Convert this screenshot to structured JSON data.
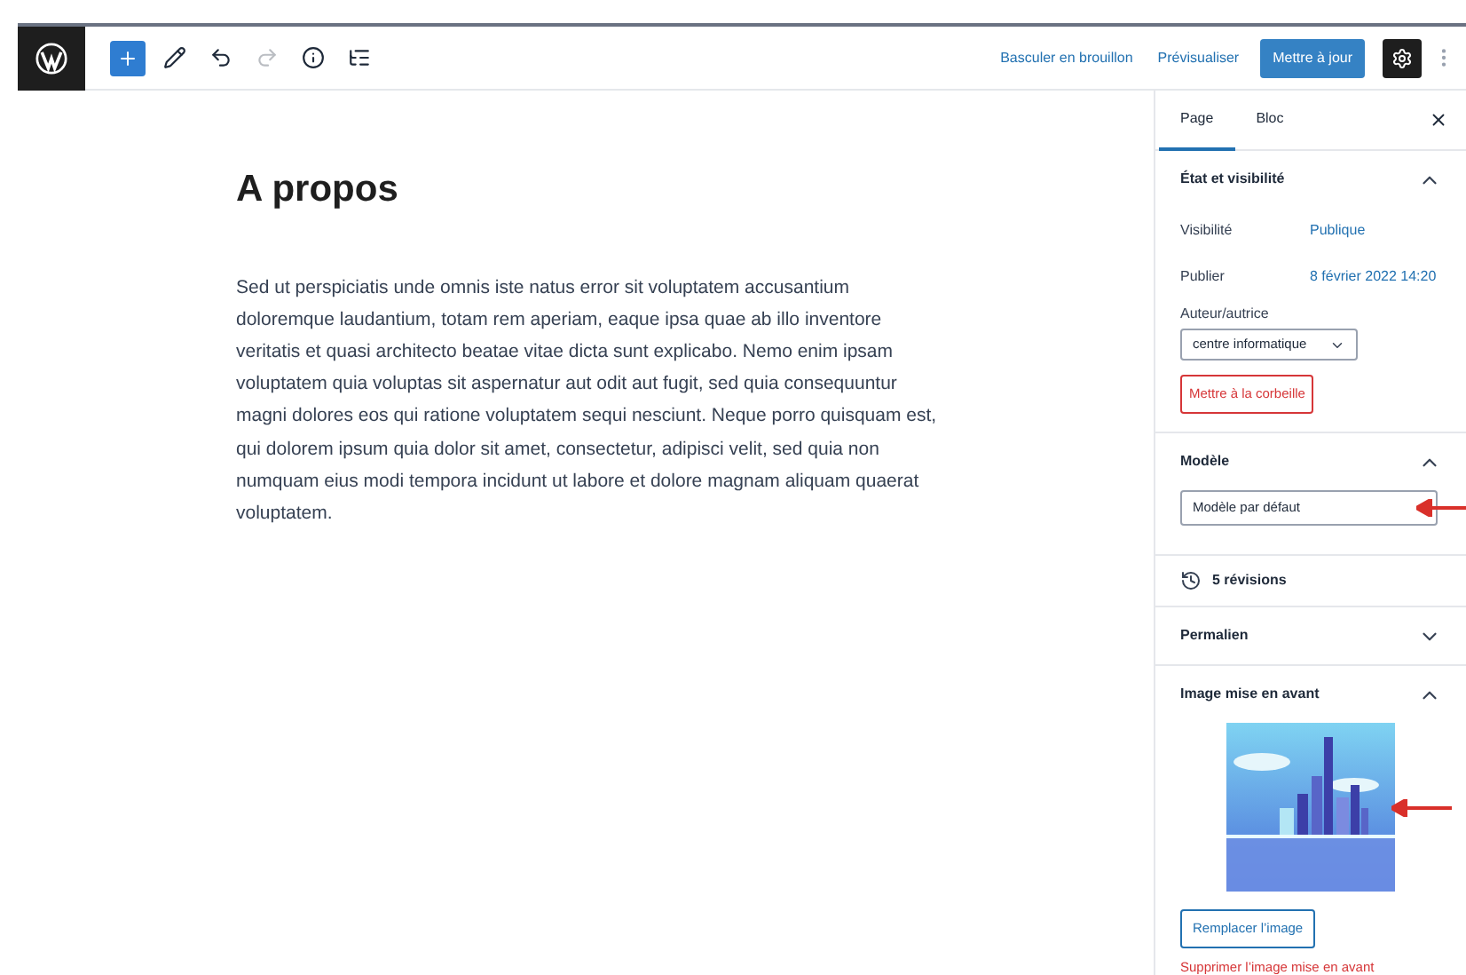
{
  "toolbar": {
    "tools": [
      {
        "kind": "add",
        "disabled": false
      },
      {
        "kind": "edit",
        "disabled": false
      },
      {
        "kind": "undo",
        "disabled": false
      },
      {
        "kind": "redo",
        "disabled": true
      },
      {
        "kind": "info",
        "disabled": false
      },
      {
        "kind": "outline",
        "disabled": false
      }
    ],
    "draft_link": "Basculer en brouillon",
    "preview_link": "Prévisualiser",
    "update_button": "Mettre à jour",
    "settings_on": true
  },
  "document": {
    "title": "A propos",
    "paragraph": "Sed ut perspiciatis unde omnis iste natus error sit voluptatem accusantium doloremque laudantium, totam rem aperiam, eaque ipsa quae ab illo inventore veritatis et quasi architecto beatae vitae dicta sunt explicabo. Nemo enim ipsam voluptatem quia voluptas sit aspernatur aut odit aut fugit, sed quia consequuntur magni dolores eos qui ratione voluptatem sequi nesciunt. Neque porro quisquam est, qui dolorem ipsum quia dolor sit amet, consectetur, adipisci velit, sed quia non numquam eius modi tempora incidunt ut labore et dolore magnam aliquam quaerat voluptatem."
  },
  "sidebar": {
    "tabs": [
      {
        "label": "Page",
        "selected": true
      },
      {
        "label": "Bloc",
        "selected": false
      }
    ],
    "panels": [
      {
        "kind": "status",
        "title": "État et visibilité",
        "expanded": true,
        "rows": [
          {
            "label": "Visibilité",
            "value": "Publique"
          },
          {
            "label": "Publier",
            "value": "8 février 2022 14:20"
          }
        ],
        "author_label": "Auteur/autrice",
        "author_value": "centre informatique",
        "trash_button": "Mettre à la corbeille"
      },
      {
        "kind": "template",
        "title": "Modèle",
        "expanded": true,
        "select_value": "Modèle par défaut",
        "annotated": true
      },
      {
        "kind": "revisions",
        "title": "5 révisions"
      },
      {
        "kind": "plain",
        "title": "Permalien",
        "expanded": false
      },
      {
        "kind": "image",
        "title": "Image mise en avant",
        "expanded": true,
        "annotated": true,
        "replace_button": "Remplacer l’image",
        "remove_link": "Supprimer l’image mise en avant"
      }
    ]
  }
}
